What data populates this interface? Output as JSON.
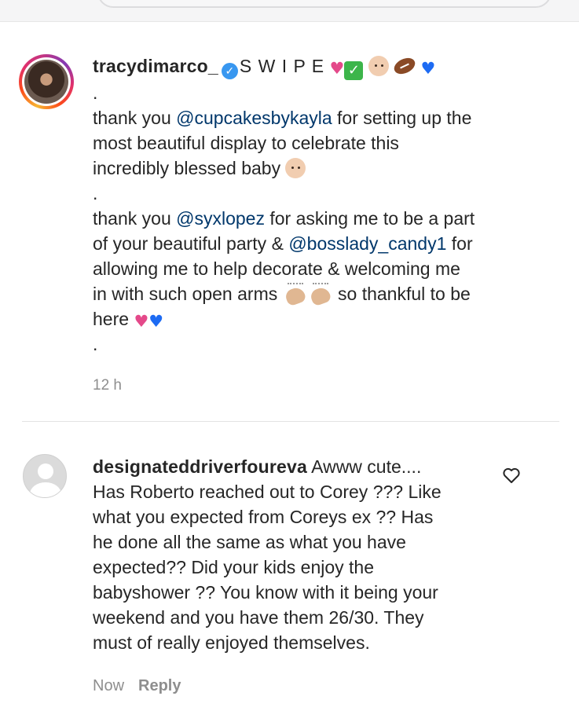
{
  "post": {
    "username": "tracydimarco_",
    "headline": "S W I P E",
    "dot": ".",
    "p1_a": "thank you ",
    "p1_mention": "@cupcakesbykayla",
    "p1_b": " for setting up the",
    "p1_line2": "most beautiful display to celebrate this",
    "p1_line3": "incredibly blessed baby",
    "p2_a": "thank you ",
    "p2_mention1": "@syxlopez",
    "p2_b": " for asking me to be a part",
    "p2_line2_a": "of your beautiful party & ",
    "p2_mention2": "@bosslady_candy1",
    "p2_line2_b": " for",
    "p2_line3": "allowing me to help decorate & welcoming me",
    "p2_line4_a": "in with such open arms",
    "p2_line4_b": " so thankful to be",
    "p2_line5": "here",
    "timestamp": "12 h",
    "icons": [
      "verified-badge",
      "pink-heart",
      "check-mark",
      "baby-face",
      "football",
      "blue-heart",
      "clapping-hands"
    ]
  },
  "comment": {
    "username": "designateddriverfoureva",
    "lines": [
      "Awww cute....",
      "Has Roberto reached out to Corey ??? Like",
      "what you expected from Coreys ex ?? Has",
      "he done all the same as what you have",
      "expected?? Did your kids enjoy the",
      "babyshower ?? You know with it being your",
      "weekend and you have them 26/30. They",
      "must of really enjoyed themselves."
    ],
    "time": "Now",
    "reply_label": "Reply"
  },
  "colors": {
    "text": "#262626",
    "mention": "#00376b",
    "muted": "#8e8e8e",
    "verified": "#3897f0"
  }
}
